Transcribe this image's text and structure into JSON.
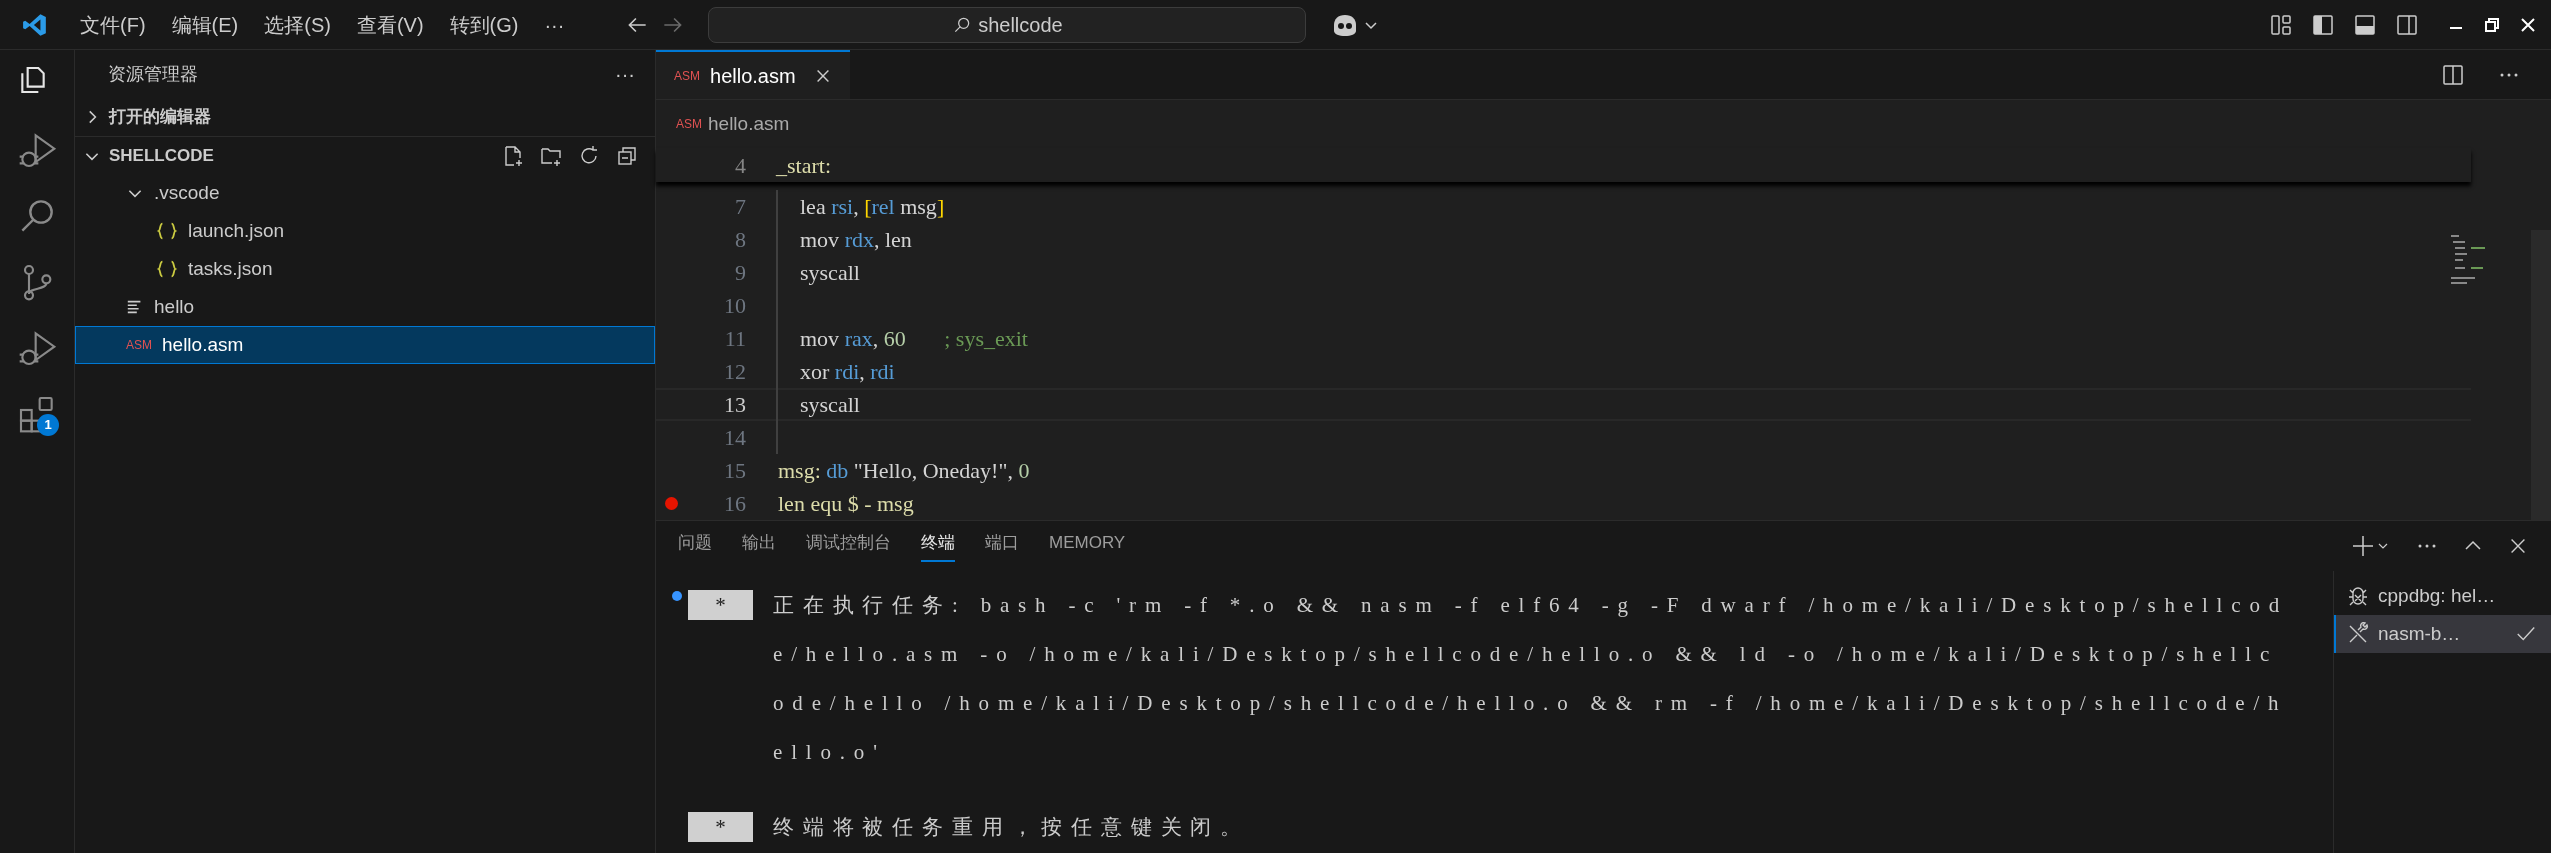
{
  "menu": [
    "文件(F)",
    "编辑(E)",
    "选择(S)",
    "查看(V)",
    "转到(G)",
    "···"
  ],
  "search": {
    "value": "shellcode"
  },
  "activity": [
    {
      "kind": "files",
      "selected": true
    },
    {
      "kind": "debug",
      "selected": false
    },
    {
      "kind": "search",
      "selected": false
    },
    {
      "kind": "branch",
      "selected": false
    },
    {
      "kind": "debug",
      "selected": false
    },
    {
      "kind": "extensions",
      "selected": false,
      "badge": "1"
    }
  ],
  "sidebar": {
    "title": "资源管理器",
    "more": "···",
    "sections": [
      {
        "label": "打开的编辑器",
        "expanded": false
      },
      {
        "label": "SHELLCODE",
        "expanded": true
      }
    ],
    "tree": [
      {
        "label": ".vscode",
        "kind": "folder",
        "expanded": true,
        "selected": false,
        "children": [
          {
            "label": "launch.json",
            "kind": "json",
            "selected": false
          },
          {
            "label": "tasks.json",
            "kind": "json",
            "selected": false
          }
        ]
      },
      {
        "label": "hello",
        "kind": "binary",
        "selected": false
      },
      {
        "label": "hello.asm",
        "kind": "asm",
        "badge": "ASM",
        "selected": true
      }
    ]
  },
  "editor": {
    "tabs": [
      {
        "label": "hello.asm",
        "badge": "ASM",
        "selected": true
      }
    ],
    "breadcrumb": {
      "label": "hello.asm",
      "badge": "ASM"
    },
    "sticky": {
      "number": "4",
      "tokens": [
        {
          "t": "_start:",
          "kind": "label"
        }
      ]
    },
    "lines": [
      {
        "number": "7",
        "indent": true,
        "current": false,
        "breakpoint": false,
        "tokens": [
          {
            "t": "lea ",
            "kind": "text"
          },
          {
            "t": "rsi",
            "kind": "keyword"
          },
          {
            "t": ", ",
            "kind": "text"
          },
          {
            "t": "[",
            "kind": "bracket"
          },
          {
            "t": "rel",
            "kind": "keyword"
          },
          {
            "t": " msg",
            "kind": "text"
          },
          {
            "t": "]",
            "kind": "bracket"
          }
        ]
      },
      {
        "number": "8",
        "indent": true,
        "current": false,
        "breakpoint": false,
        "tokens": [
          {
            "t": "mov ",
            "kind": "text"
          },
          {
            "t": "rdx",
            "kind": "keyword"
          },
          {
            "t": ", len",
            "kind": "text"
          }
        ]
      },
      {
        "number": "9",
        "indent": true,
        "current": false,
        "breakpoint": false,
        "tokens": [
          {
            "t": "syscall",
            "kind": "text"
          }
        ]
      },
      {
        "number": "10",
        "indent": true,
        "current": false,
        "breakpoint": false
      },
      {
        "number": "11",
        "indent": true,
        "current": false,
        "breakpoint": false,
        "tokens": [
          {
            "t": "mov ",
            "kind": "text"
          },
          {
            "t": "rax",
            "kind": "keyword"
          },
          {
            "t": ", ",
            "kind": "text"
          },
          {
            "t": "60",
            "kind": "number"
          },
          {
            "t": "       ; sys_exit",
            "kind": "comment"
          }
        ]
      },
      {
        "number": "12",
        "indent": true,
        "current": false,
        "breakpoint": false,
        "tokens": [
          {
            "t": "xor ",
            "kind": "text"
          },
          {
            "t": "rdi",
            "kind": "keyword"
          },
          {
            "t": ", ",
            "kind": "text"
          },
          {
            "t": "rdi",
            "kind": "keyword"
          }
        ]
      },
      {
        "number": "13",
        "indent": true,
        "current": true,
        "breakpoint": false,
        "tokens": [
          {
            "t": "syscall",
            "kind": "text"
          }
        ]
      },
      {
        "number": "14",
        "indent": true,
        "current": false,
        "breakpoint": false
      },
      {
        "number": "15",
        "indent": false,
        "current": false,
        "breakpoint": false,
        "tokens": [
          {
            "t": "msg: ",
            "kind": "label"
          },
          {
            "t": "db",
            "kind": "keyword"
          },
          {
            "t": " \"Hello, Oneday!\", ",
            "kind": "text"
          },
          {
            "t": "0",
            "kind": "number"
          }
        ]
      },
      {
        "number": "16",
        "indent": false,
        "current": false,
        "breakpoint": true,
        "tokens": [
          {
            "t": "len equ $ - msg",
            "kind": "label"
          }
        ]
      }
    ]
  },
  "panel": {
    "tabs": [
      {
        "label": "问题",
        "selected": false
      },
      {
        "label": "输出",
        "selected": false
      },
      {
        "label": "调试控制台",
        "selected": false
      },
      {
        "label": "终端",
        "selected": true
      },
      {
        "label": "端口",
        "selected": false
      },
      {
        "label": "MEMORY",
        "selected": false
      }
    ],
    "terminal": [
      {
        "marker": "*",
        "dot": true,
        "text": "正在执行任务: bash -c 'rm -f *.o && nasm -f elf64 -g -F dwarf /home/kali/Desktop/shellcode/hello.asm -o /home/kali/Desktop/shellcode/hello.o && ld -o /home/kali/Desktop/shellcode/hello /home/kali/Desktop/shellcode/hello.o && rm -f /home/kali/Desktop/shellcode/hello.o'"
      },
      {
        "marker": "*",
        "dot": false,
        "text": "终端将被任务重用，按任意键关闭。"
      }
    ],
    "terminals": [
      {
        "label": "cppdbg: hel…",
        "kind": "debug",
        "selected": false,
        "done": false
      },
      {
        "label": "nasm-b…",
        "kind": "tools",
        "selected": true,
        "done": true
      }
    ]
  }
}
